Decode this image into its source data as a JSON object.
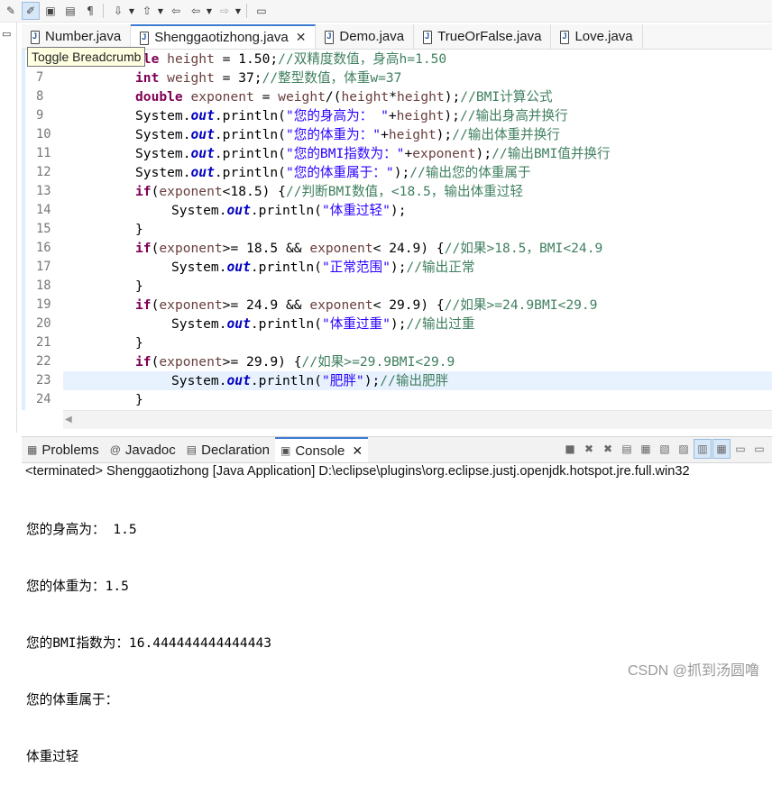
{
  "toolbar": {
    "buttons": [
      "toggle-mark-occurrences-icon",
      "toggle-breadcrumb-icon",
      "block-selection-icon",
      "show-whitespace-icon",
      "paragraph-icon",
      "next-annotation-icon",
      "previous-annotation-icon",
      "last-edit-icon",
      "back-icon",
      "forward-icon",
      "pin-editor-icon"
    ]
  },
  "tooltip": "Toggle Breadcrumb",
  "editor_tabs": [
    {
      "label": "Number.java",
      "active": false
    },
    {
      "label": "Shenggaotizhong.java",
      "active": true
    },
    {
      "label": "Demo.java",
      "active": false
    },
    {
      "label": "TrueOrFalse.java",
      "active": false
    },
    {
      "label": "Love.java",
      "active": false
    }
  ],
  "editor": {
    "lines": [
      {
        "n": "",
        "indent": 2,
        "tokens": [
          [
            "kw",
            "ble"
          ],
          [
            "",
            " "
          ],
          [
            "var",
            "height"
          ],
          [
            "",
            " = 1.50;"
          ],
          [
            "cmt",
            "//双精度数值，身高h=1.50"
          ]
        ]
      },
      {
        "n": "7",
        "indent": 2,
        "tokens": [
          [
            "kw",
            "int"
          ],
          [
            "",
            " "
          ],
          [
            "var",
            "weight"
          ],
          [
            "",
            " = 37;"
          ],
          [
            "cmt",
            "//整型数值，体重w=37"
          ]
        ]
      },
      {
        "n": "8",
        "indent": 2,
        "tokens": [
          [
            "kw",
            "double"
          ],
          [
            "",
            " "
          ],
          [
            "var",
            "exponent"
          ],
          [
            "",
            " = "
          ],
          [
            "var",
            "weight"
          ],
          [
            "",
            "/("
          ],
          [
            "var",
            "height"
          ],
          [
            "",
            "*"
          ],
          [
            "var",
            "height"
          ],
          [
            "",
            ");"
          ],
          [
            "cmt",
            "//BMI计算公式"
          ]
        ]
      },
      {
        "n": "9",
        "indent": 2,
        "tokens": [
          [
            "",
            "System."
          ],
          [
            "fld",
            "out"
          ],
          [
            "",
            ".println("
          ],
          [
            "str",
            "\"您的身高为： \""
          ],
          [
            "",
            "+"
          ],
          [
            "var",
            "height"
          ],
          [
            "",
            ");"
          ],
          [
            "cmt",
            "//输出身高并换行"
          ]
        ]
      },
      {
        "n": "10",
        "indent": 2,
        "tokens": [
          [
            "",
            "System."
          ],
          [
            "fld",
            "out"
          ],
          [
            "",
            ".println("
          ],
          [
            "str",
            "\"您的体重为：\""
          ],
          [
            "",
            "+"
          ],
          [
            "var",
            "height"
          ],
          [
            "",
            ");"
          ],
          [
            "cmt",
            "//输出体重并换行"
          ]
        ]
      },
      {
        "n": "11",
        "indent": 2,
        "tokens": [
          [
            "",
            "System."
          ],
          [
            "fld",
            "out"
          ],
          [
            "",
            ".println("
          ],
          [
            "str",
            "\"您的BMI指数为：\""
          ],
          [
            "",
            "+"
          ],
          [
            "var",
            "exponent"
          ],
          [
            "",
            ");"
          ],
          [
            "cmt",
            "//输出BMI值并换行"
          ]
        ]
      },
      {
        "n": "12",
        "indent": 2,
        "tokens": [
          [
            "",
            "System."
          ],
          [
            "fld",
            "out"
          ],
          [
            "",
            ".println("
          ],
          [
            "str",
            "\"您的体重属于：\""
          ],
          [
            "",
            ");"
          ],
          [
            "cmt",
            "//输出您的体重属于"
          ]
        ]
      },
      {
        "n": "13",
        "indent": 2,
        "tokens": [
          [
            "kw",
            "if"
          ],
          [
            "",
            "("
          ],
          [
            "var",
            "exponent"
          ],
          [
            "",
            "<18.5) {"
          ],
          [
            "cmt",
            "//判断BMI数值，<18.5，输出体重过轻"
          ]
        ]
      },
      {
        "n": "14",
        "indent": 3,
        "tokens": [
          [
            "",
            "System."
          ],
          [
            "fld",
            "out"
          ],
          [
            "",
            ".println("
          ],
          [
            "str",
            "\"体重过轻\""
          ],
          [
            "",
            ");"
          ]
        ]
      },
      {
        "n": "15",
        "indent": 2,
        "tokens": [
          [
            "",
            "}"
          ]
        ]
      },
      {
        "n": "16",
        "indent": 2,
        "tokens": [
          [
            "kw",
            "if"
          ],
          [
            "",
            "("
          ],
          [
            "var",
            "exponent"
          ],
          [
            "",
            ">= 18.5 && "
          ],
          [
            "var",
            "exponent"
          ],
          [
            "",
            "< 24.9) {"
          ],
          [
            "cmt",
            "//如果>18.5，BMI<24.9"
          ]
        ]
      },
      {
        "n": "17",
        "indent": 3,
        "tokens": [
          [
            "",
            "System."
          ],
          [
            "fld",
            "out"
          ],
          [
            "",
            ".println("
          ],
          [
            "str",
            "\"正常范围\""
          ],
          [
            "",
            ");"
          ],
          [
            "cmt",
            "//输出正常"
          ]
        ]
      },
      {
        "n": "18",
        "indent": 2,
        "tokens": [
          [
            "",
            "}"
          ]
        ]
      },
      {
        "n": "19",
        "indent": 2,
        "tokens": [
          [
            "kw",
            "if"
          ],
          [
            "",
            "("
          ],
          [
            "var",
            "exponent"
          ],
          [
            "",
            ">= 24.9 && "
          ],
          [
            "var",
            "exponent"
          ],
          [
            "",
            "< 29.9) {"
          ],
          [
            "cmt",
            "//如果>=24.9BMI<29.9"
          ]
        ]
      },
      {
        "n": "20",
        "indent": 3,
        "tokens": [
          [
            "",
            "System."
          ],
          [
            "fld",
            "out"
          ],
          [
            "",
            ".println("
          ],
          [
            "str",
            "\"体重过重\""
          ],
          [
            "",
            ");"
          ],
          [
            "cmt",
            "//输出过重"
          ]
        ]
      },
      {
        "n": "21",
        "indent": 2,
        "tokens": [
          [
            "",
            "}"
          ]
        ]
      },
      {
        "n": "22",
        "indent": 2,
        "tokens": [
          [
            "kw",
            "if"
          ],
          [
            "",
            "("
          ],
          [
            "var",
            "exponent"
          ],
          [
            "",
            ">= 29.9) {"
          ],
          [
            "cmt",
            "//如果>=29.9BMI<29.9"
          ]
        ]
      },
      {
        "n": "23",
        "indent": 3,
        "current": true,
        "tokens": [
          [
            "",
            "System."
          ],
          [
            "fld",
            "out"
          ],
          [
            "",
            ".println("
          ],
          [
            "str",
            "\"肥胖\""
          ],
          [
            "",
            ");"
          ],
          [
            "cmt",
            "//输出肥胖"
          ]
        ]
      },
      {
        "n": "24",
        "indent": 2,
        "tokens": [
          [
            "",
            "}"
          ]
        ]
      }
    ]
  },
  "console_panel": {
    "tabs": [
      {
        "label": "Problems",
        "icon": "problems-icon",
        "active": false
      },
      {
        "label": "Javadoc",
        "icon": "javadoc-icon",
        "active": false
      },
      {
        "label": "Declaration",
        "icon": "declaration-icon",
        "active": false
      },
      {
        "label": "Console",
        "icon": "console-icon",
        "active": true
      }
    ],
    "terminated_line": "<terminated> Shenggaotizhong [Java Application] D:\\eclipse\\plugins\\org.eclipse.justj.openjdk.hotspot.jre.full.win32",
    "output_lines": [
      "您的身高为： 1.5",
      "您的体重为：1.5",
      "您的BMI指数为：16.444444444444443",
      "您的体重属于：",
      "体重过轻"
    ]
  },
  "watermark": "CSDN @抓到汤圆噜"
}
